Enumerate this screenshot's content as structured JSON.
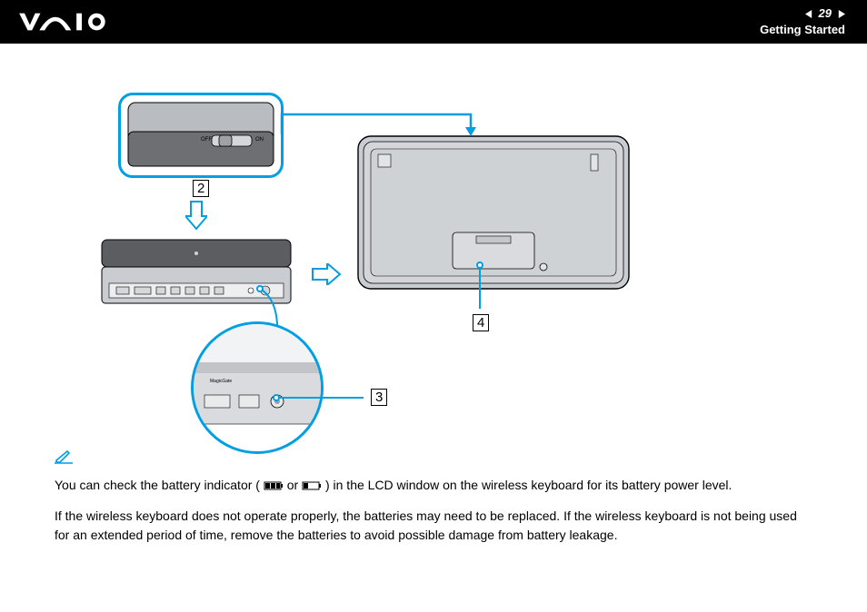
{
  "header": {
    "page_number": "29",
    "section": "Getting Started"
  },
  "diagram": {
    "switch_off": "OFF",
    "switch_on": "ON",
    "port_label": "MagicGate",
    "callout_2": "2",
    "callout_3": "3",
    "callout_4": "4"
  },
  "text": {
    "note_line1_a": "You can check the battery indicator (",
    "note_line1_b": " or ",
    "note_line1_c": ") in the LCD window on the wireless keyboard for its battery power level.",
    "note_line2": "If the wireless keyboard does not operate properly, the batteries may need to be replaced. If the wireless keyboard is not being used for an extended period of time, remove the batteries to avoid possible damage from battery leakage."
  }
}
